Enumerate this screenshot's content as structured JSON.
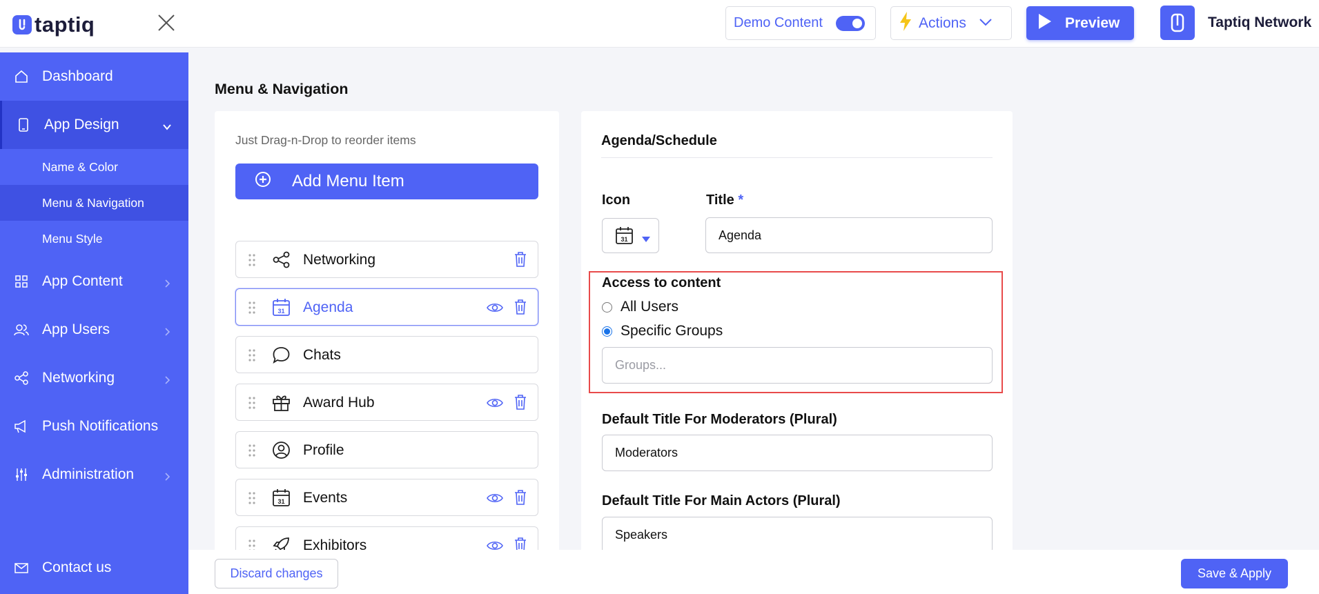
{
  "header": {
    "logo_text": "taptiq",
    "demo_content_label": "Demo Content",
    "demo_content_enabled": true,
    "actions_label": "Actions",
    "preview_label": "Preview",
    "org_name": "Taptiq Network"
  },
  "sidebar": {
    "items": [
      {
        "label": "Dashboard",
        "icon": "home-icon"
      },
      {
        "label": "App Design",
        "icon": "phone-icon"
      },
      {
        "label": "App Content",
        "icon": "grid-icon"
      },
      {
        "label": "App Users",
        "icon": "users-icon"
      },
      {
        "label": "Networking",
        "icon": "share-icon"
      },
      {
        "label": "Push Notifications",
        "icon": "megaphone-icon"
      },
      {
        "label": "Administration",
        "icon": "sliders-icon"
      },
      {
        "label": "Contact us",
        "icon": "mail-icon"
      }
    ],
    "sub_items": [
      {
        "label": "Name & Color"
      },
      {
        "label": "Menu & Navigation"
      },
      {
        "label": "Menu Style"
      }
    ]
  },
  "main": {
    "page_title": "Menu & Navigation",
    "menu_panel": {
      "hint": "Just Drag-n-Drop to reorder items",
      "add_button_label": "Add Menu Item",
      "items": [
        {
          "label": "Networking",
          "icon": "share-icon"
        },
        {
          "label": "Agenda",
          "icon": "calendar-icon"
        },
        {
          "label": "Chats",
          "icon": "chat-bubble-icon"
        },
        {
          "label": "Award Hub",
          "icon": "gift-icon"
        },
        {
          "label": "Profile",
          "icon": "user-circle-icon"
        },
        {
          "label": "Events",
          "icon": "calendar-icon"
        },
        {
          "label": "Exhibitors",
          "icon": "rocket-icon"
        }
      ]
    },
    "detail_panel": {
      "section_title": "Agenda/Schedule",
      "icon_label": "Icon",
      "title_label": "Title",
      "required_mark": "*",
      "title_value": "Agenda",
      "calendar_day": "31",
      "access_label": "Access to content",
      "access_options": [
        "All Users",
        "Specific Groups"
      ],
      "access_selected": "Specific Groups",
      "groups_placeholder": "Groups...",
      "moderators_label": "Default Title For Moderators (Plural)",
      "moderators_value": "Moderators",
      "main_actors_label": "Default Title For Main Actors (Plural)",
      "main_actors_value": "Speakers"
    }
  },
  "footer": {
    "discard_label": "Discard changes",
    "save_label": "Save & Apply"
  },
  "colors": {
    "accent": "#4f63f5",
    "sidebar_active": "#3f51e3",
    "highlight_border": "#e84a4a",
    "radio_selected": "#1a73e8"
  }
}
